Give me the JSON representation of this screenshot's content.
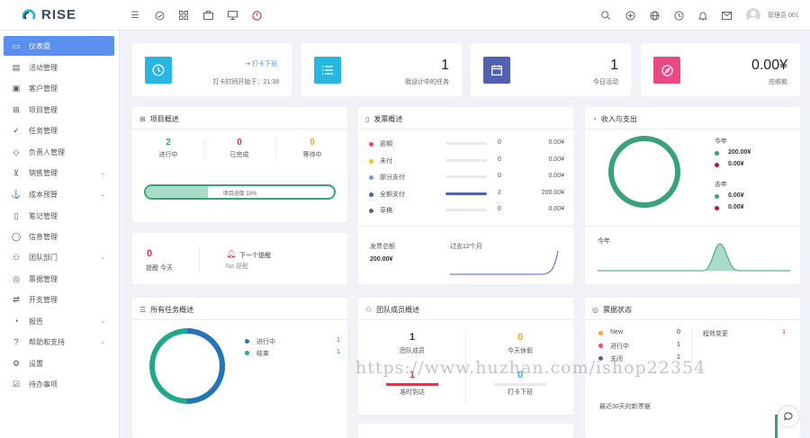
{
  "app": {
    "name": "RISE"
  },
  "header": {
    "user_name": "管理员 001"
  },
  "sidebar": {
    "items": [
      {
        "label": "仪表盘"
      },
      {
        "label": "活动管理"
      },
      {
        "label": "客户管理"
      },
      {
        "label": "项目管理"
      },
      {
        "label": "任务管理"
      },
      {
        "label": "负责人管理"
      },
      {
        "label": "销售管理"
      },
      {
        "label": "成本预算"
      },
      {
        "label": "笔记管理"
      },
      {
        "label": "信息管理"
      },
      {
        "label": "团队部门"
      },
      {
        "label": "票据管理"
      },
      {
        "label": "开支管理"
      },
      {
        "label": "报告"
      },
      {
        "label": "帮助和支持"
      },
      {
        "label": "设置"
      },
      {
        "label": "待办事项"
      }
    ]
  },
  "stats": {
    "clock": {
      "button": "打卡下班",
      "text": "打卡时间开始于：21:38"
    },
    "tasks": {
      "value": "1",
      "label": "我设计中的任务"
    },
    "events": {
      "value": "1",
      "label": "今日活动"
    },
    "due": {
      "value": "0.00¥",
      "label": "应收款"
    }
  },
  "project_overview": {
    "title": "项目概述",
    "in_progress": {
      "value": "2",
      "label": "进行中"
    },
    "completed": {
      "value": "0",
      "label": "已完成"
    },
    "waiting": {
      "value": "0",
      "label": "等待中"
    },
    "progress_label": "项目进度 33%",
    "progress": 0.33
  },
  "reminders": {
    "count": "0",
    "count_label": "提醒 今天",
    "next_label": "下一个提醒",
    "next_value": "No 提醒"
  },
  "invoice_overview": {
    "title": "发票概述",
    "rows": [
      {
        "label": "逾期",
        "count": "0",
        "amount": "0.00¥",
        "color": "#e74c6b",
        "fill": 0
      },
      {
        "label": "未付",
        "count": "0",
        "amount": "0.00¥",
        "color": "#f5c518",
        "fill": 0
      },
      {
        "label": "部分支付",
        "count": "0",
        "amount": "0.00¥",
        "color": "#6d9be8",
        "fill": 0
      },
      {
        "label": "全额支付",
        "count": "2",
        "amount": "200.00¥",
        "color": "#5160b0",
        "fill": 1
      },
      {
        "label": "草稿",
        "count": "0",
        "amount": "0.00¥",
        "color": "#666666",
        "fill": 0
      }
    ],
    "total_label": "发票总额",
    "total_value": "200.00¥",
    "period_label": "过去12个月"
  },
  "income_expense": {
    "title": "收入与支出",
    "this_year": "今年",
    "last_year": "去年",
    "this_income": "200.00¥",
    "this_expense": "0.00¥",
    "last_income": "0.00¥",
    "last_expense": "0.00¥",
    "chart_label": "今年"
  },
  "all_tasks": {
    "title": "所有任务概述",
    "rows": [
      {
        "label": "进行中",
        "value": "1",
        "color": "#2574b5"
      },
      {
        "label": "结束",
        "value": "1",
        "color": "#1fa88a"
      }
    ]
  },
  "team": {
    "title": "团队成员概述",
    "members": {
      "value": "1",
      "label": "团队成员"
    },
    "on_leave": {
      "value": "0",
      "label": "今天休假"
    },
    "clocked_in": {
      "value": "1",
      "label": "准时到达"
    },
    "clocked_out": {
      "value": "0",
      "label": "打卡下班"
    }
  },
  "ticket_status": {
    "title": "票据状态",
    "rows": [
      {
        "label": "New",
        "value": "0",
        "color": "#f0a830"
      },
      {
        "label": "进行中",
        "value": "1",
        "color": "#e74c6b"
      },
      {
        "label": "关闭",
        "value": "1",
        "color": "#6a58a8"
      }
    ],
    "type_label": "程效变更",
    "type_value": "1",
    "recent_label": "最近30天的新票据"
  },
  "watermark": "https://www.huzhan.com/ishop22354",
  "colors": {
    "accent": "#5b8ff0",
    "green": "#3aa27a",
    "teal": "#29b6e0",
    "purple": "#5160b0",
    "pink": "#e94a86"
  }
}
